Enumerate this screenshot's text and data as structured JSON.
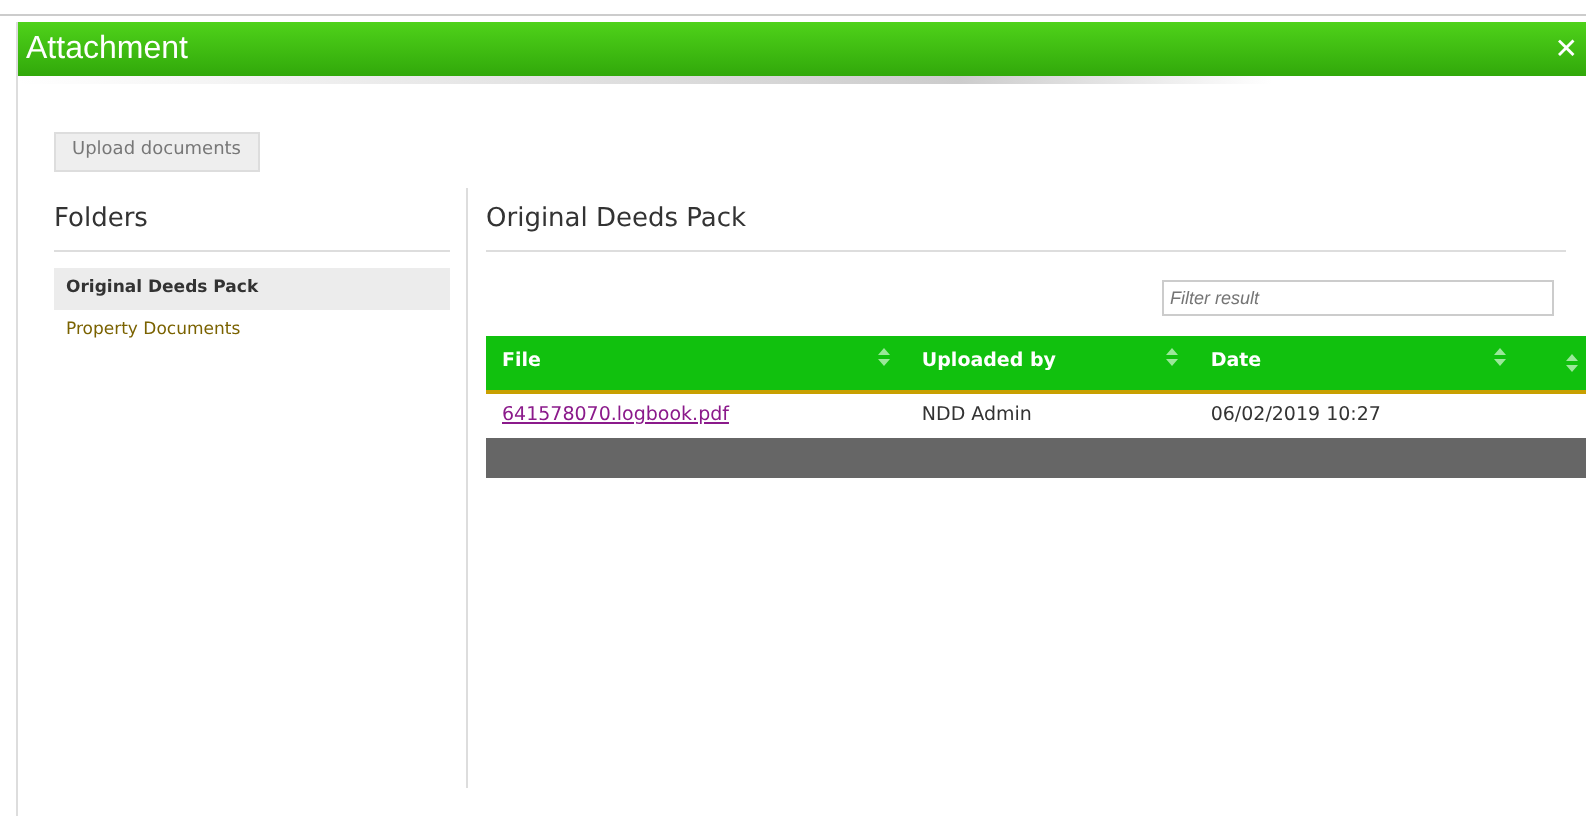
{
  "window": {
    "title": "Attachment",
    "close": "✕"
  },
  "upload_button": {
    "label": "Upload documents",
    "disabled": true
  },
  "folders": {
    "heading": "Folders",
    "items": [
      {
        "label": "Original Deeds Pack",
        "selected": true
      },
      {
        "label": "Property Documents",
        "selected": false
      }
    ]
  },
  "panel": {
    "heading": "Original Deeds Pack",
    "filter": {
      "placeholder": "Filter result"
    },
    "table": {
      "columns": [
        "File",
        "Uploaded by",
        "Date",
        ""
      ],
      "rows": [
        {
          "cells": [
            "641578070.logbook.pdf",
            "NDD Admin",
            "06/02/2019 10:27",
            ""
          ]
        }
      ]
    }
  }
}
